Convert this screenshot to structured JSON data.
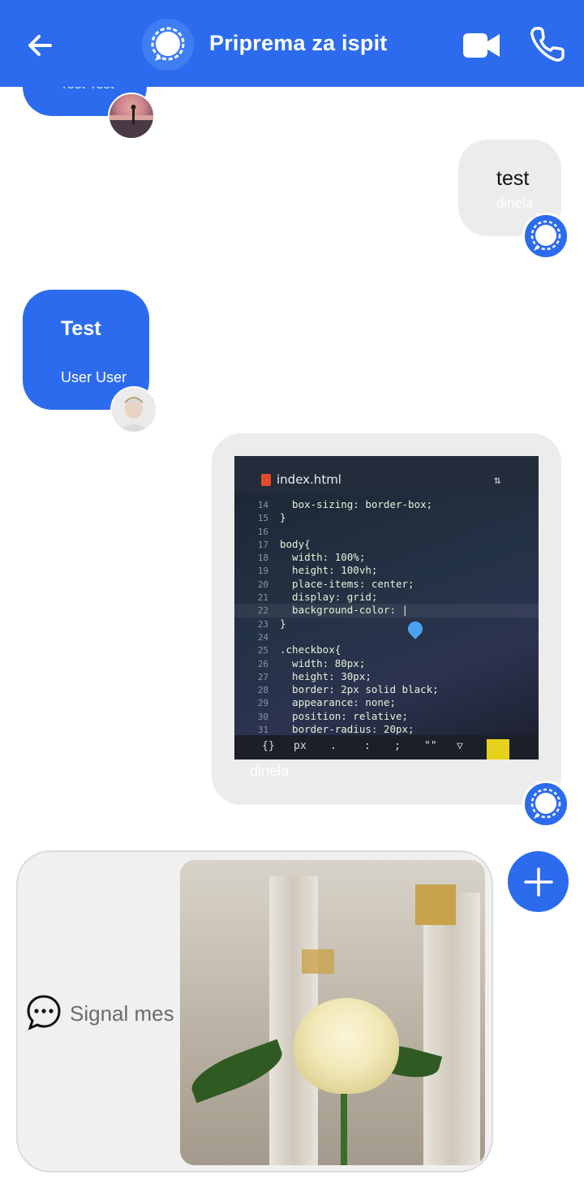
{
  "header": {
    "title": "Priprema za ispit",
    "background": "#2c6bed"
  },
  "messages": [
    {
      "id": "m0",
      "side": "left",
      "text": "",
      "sender": "Test Test",
      "avatar": "sunset-photo-avatar"
    },
    {
      "id": "m1",
      "side": "right",
      "text": "test",
      "sender": "dinela",
      "avatar": "signal-logo-avatar"
    },
    {
      "id": "m2",
      "side": "left",
      "text": "Test",
      "sender": "User User",
      "avatar": "portrait-avatar"
    },
    {
      "id": "m3",
      "side": "right",
      "sender": "dinela",
      "avatar": "signal-logo-avatar",
      "image": {
        "file_name": "index.html",
        "code_lines": [
          {
            "n": "14",
            "code": "  box-sizing: border-box;"
          },
          {
            "n": "15",
            "code": "}"
          },
          {
            "n": "16",
            "code": ""
          },
          {
            "n": "17",
            "code": "body{"
          },
          {
            "n": "18",
            "code": "  width: 100%;"
          },
          {
            "n": "19",
            "code": "  height: 100vh;"
          },
          {
            "n": "20",
            "code": "  place-items: center;"
          },
          {
            "n": "21",
            "code": "  display: grid;"
          },
          {
            "n": "22",
            "code": "  background-color: |"
          },
          {
            "n": "23",
            "code": "}"
          },
          {
            "n": "24",
            "code": ""
          },
          {
            "n": "25",
            "code": ".checkbox{"
          },
          {
            "n": "26",
            "code": "  width: 80px;"
          },
          {
            "n": "27",
            "code": "  height: 30px;"
          },
          {
            "n": "28",
            "code": "  border: 2px solid black;"
          },
          {
            "n": "29",
            "code": "  appearance: none;"
          },
          {
            "n": "30",
            "code": "  position: relative;"
          },
          {
            "n": "31",
            "code": "  border-radius: 20px;"
          }
        ],
        "keys": [
          "{}",
          "px",
          ".",
          ":",
          ";",
          "\"\"",
          "▽"
        ]
      }
    }
  ],
  "composer": {
    "placeholder": "Signal message",
    "attachment": "rose-photo"
  },
  "colors": {
    "accent": "#2c6bed",
    "bubble_grey": "#ececec",
    "composer_bg": "#f0f0f0"
  }
}
